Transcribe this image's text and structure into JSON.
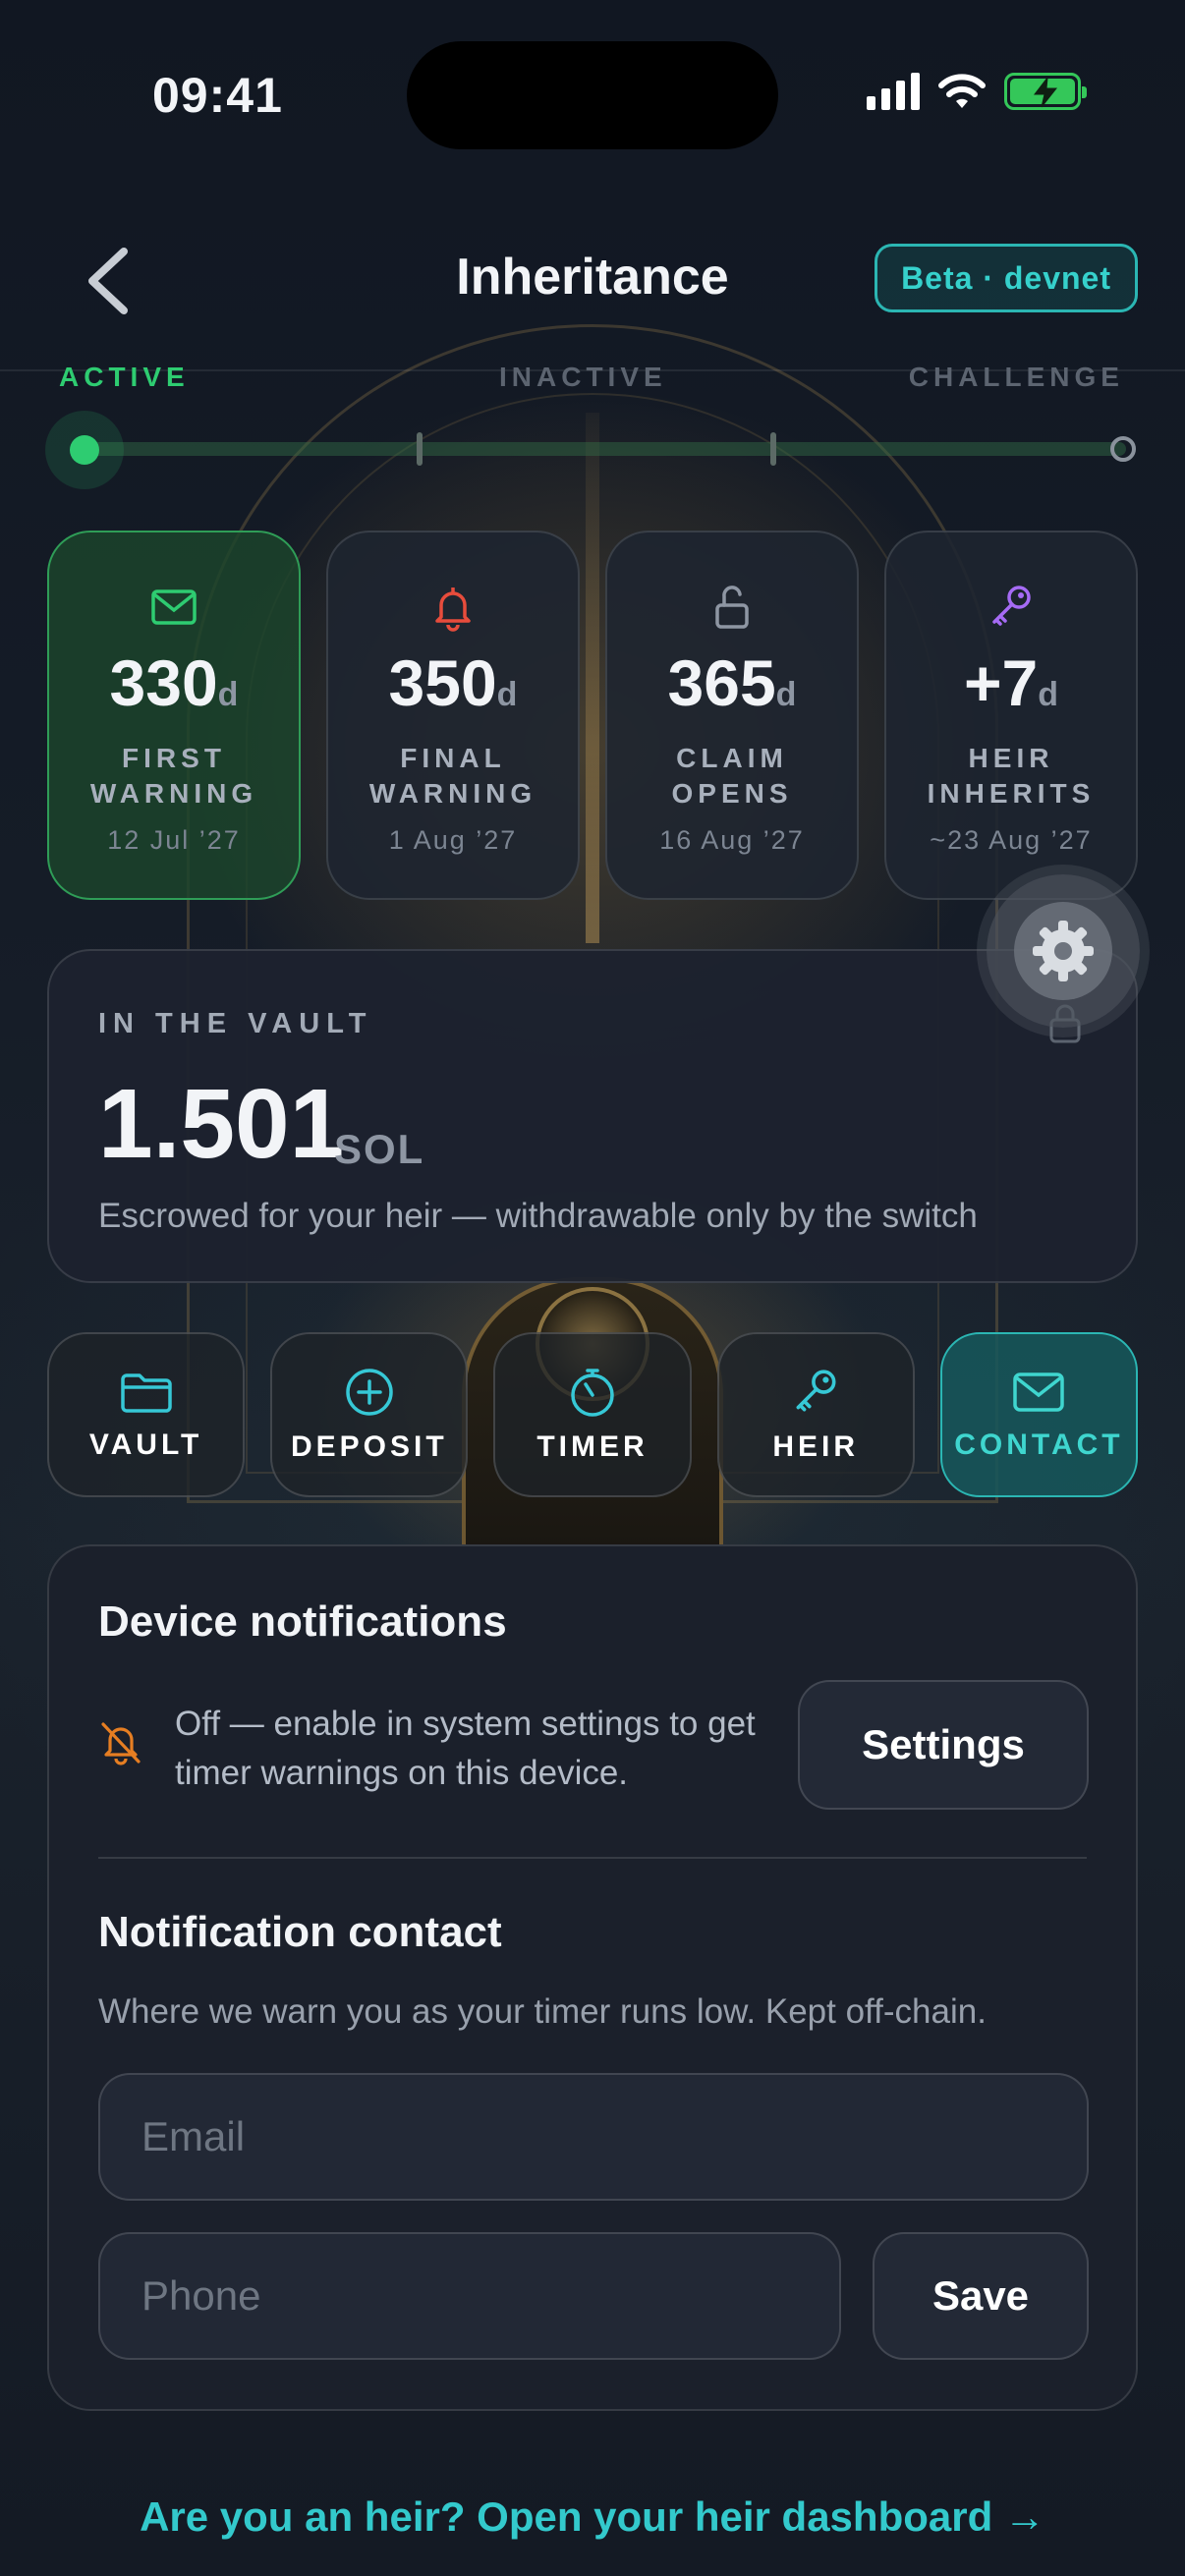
{
  "status_bar": {
    "time": "09:41"
  },
  "header": {
    "title": "Inheritance",
    "badge": "Beta · devnet"
  },
  "timeline": {
    "phases": [
      "ACTIVE",
      "INACTIVE",
      "CHALLENGE"
    ],
    "current_phase": "ACTIVE"
  },
  "milestones": [
    {
      "value": "330",
      "unit": "d",
      "label_line1": "FIRST",
      "label_line2": "WARNING",
      "date": "12 Jul ’27",
      "icon": "mail-icon",
      "color": "#2ecc71"
    },
    {
      "value": "350",
      "unit": "d",
      "label_line1": "FINAL",
      "label_line2": "WARNING",
      "date": "1 Aug ’27",
      "icon": "bell-icon",
      "color": "#e74c3c"
    },
    {
      "value": "365",
      "unit": "d",
      "label_line1": "CLAIM",
      "label_line2": "OPENS",
      "date": "16 Aug ’27",
      "icon": "unlock-icon",
      "color": "#8e96a3"
    },
    {
      "value": "+7",
      "unit": "d",
      "label_line1": "HEIR",
      "label_line2": "INHERITS",
      "date": "~23 Aug ’27",
      "icon": "key-icon",
      "color": "#a66bf5"
    }
  ],
  "vault": {
    "label": "IN THE VAULT",
    "amount": "1.501",
    "unit": "SOL",
    "description": "Escrowed for your heir — withdrawable only by the switch"
  },
  "tabs": [
    {
      "label": "VAULT",
      "icon": "folder-icon"
    },
    {
      "label": "DEPOSIT",
      "icon": "plus-circle-icon"
    },
    {
      "label": "TIMER",
      "icon": "timer-icon"
    },
    {
      "label": "HEIR",
      "icon": "key-icon"
    },
    {
      "label": "CONTACT",
      "icon": "mail-icon",
      "selected": true
    }
  ],
  "device_notifications": {
    "title": "Device notifications",
    "status_text": "Off — enable in system settings to get timer warnings on this device.",
    "button": "Settings",
    "icon": "bell-off-icon"
  },
  "notification_contact": {
    "title": "Notification contact",
    "subtitle": "Where we warn you as your timer runs low. Kept off-chain.",
    "email_placeholder": "Email",
    "phone_placeholder": "Phone",
    "save_label": "Save"
  },
  "footer": {
    "heir_link": "Are you an heir? Open your heir dashboard →"
  },
  "colors": {
    "accent": "#33c9cc",
    "active_green": "#2ecc71",
    "warning_red": "#e74c3c",
    "heir_purple": "#a66bf5"
  }
}
